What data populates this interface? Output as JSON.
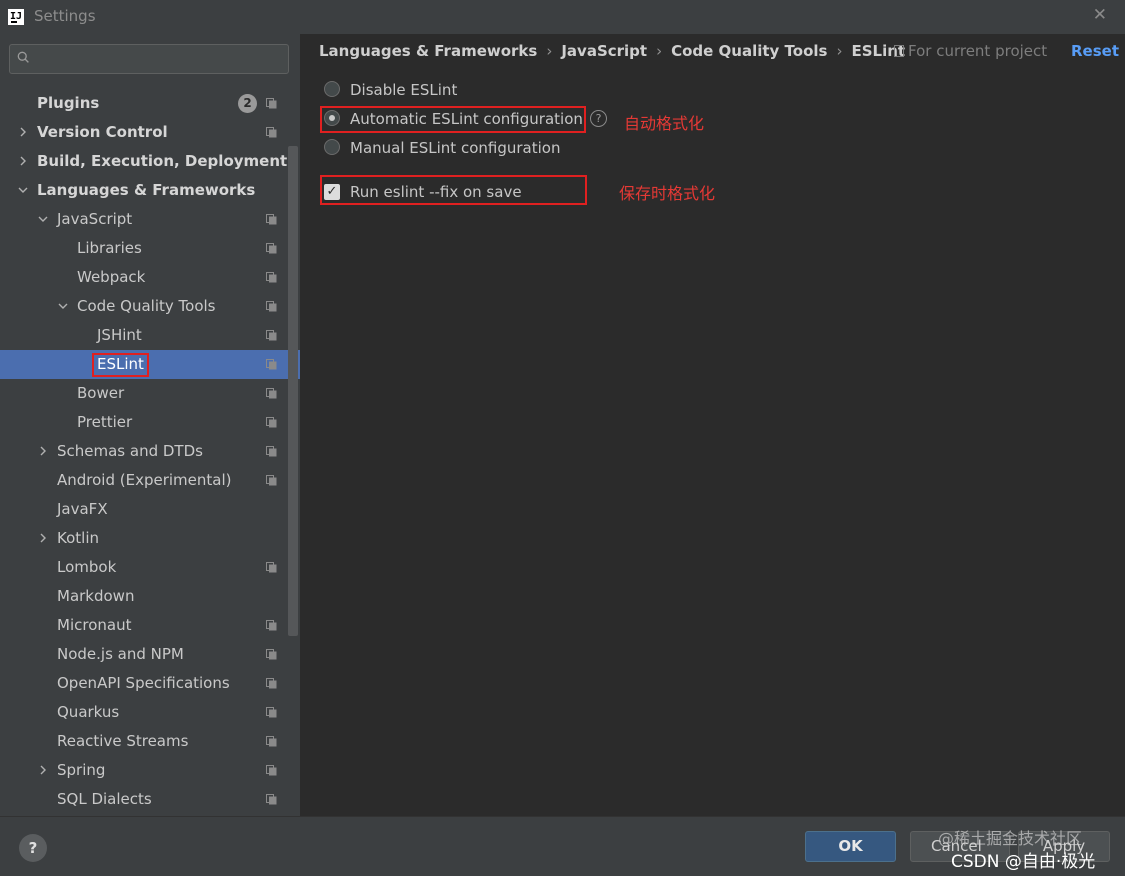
{
  "window": {
    "title": "Settings",
    "app_icon": "intellij-icon",
    "close_icon": "close-icon"
  },
  "sidebar": {
    "search": {
      "placeholder": "",
      "value": ""
    },
    "items": [
      {
        "label": "Plugins",
        "level": 0,
        "bold": true,
        "arrow": "none",
        "badge": "2",
        "project_icon": true
      },
      {
        "label": "Version Control",
        "level": 0,
        "bold": true,
        "arrow": "right",
        "project_icon": true
      },
      {
        "label": "Build, Execution, Deployment",
        "level": 0,
        "bold": true,
        "arrow": "right",
        "project_icon": false
      },
      {
        "label": "Languages & Frameworks",
        "level": 0,
        "bold": true,
        "arrow": "down",
        "project_icon": false
      },
      {
        "label": "JavaScript",
        "level": 1,
        "bold": false,
        "arrow": "down",
        "project_icon": true
      },
      {
        "label": "Libraries",
        "level": 2,
        "bold": false,
        "arrow": "none",
        "project_icon": true
      },
      {
        "label": "Webpack",
        "level": 2,
        "bold": false,
        "arrow": "none",
        "project_icon": true
      },
      {
        "label": "Code Quality Tools",
        "level": 2,
        "bold": false,
        "arrow": "down",
        "project_icon": true
      },
      {
        "label": "JSHint",
        "level": 3,
        "bold": false,
        "arrow": "none",
        "project_icon": true
      },
      {
        "label": "ESLint",
        "level": 3,
        "bold": false,
        "arrow": "none",
        "project_icon": true,
        "selected": true
      },
      {
        "label": "Bower",
        "level": 2,
        "bold": false,
        "arrow": "none",
        "project_icon": true
      },
      {
        "label": "Prettier",
        "level": 2,
        "bold": false,
        "arrow": "none",
        "project_icon": true
      },
      {
        "label": "Schemas and DTDs",
        "level": 1,
        "bold": false,
        "arrow": "right",
        "project_icon": true
      },
      {
        "label": "Android (Experimental)",
        "level": 1,
        "bold": false,
        "arrow": "none",
        "project_icon": true
      },
      {
        "label": "JavaFX",
        "level": 1,
        "bold": false,
        "arrow": "none",
        "project_icon": false
      },
      {
        "label": "Kotlin",
        "level": 1,
        "bold": false,
        "arrow": "right",
        "project_icon": false
      },
      {
        "label": "Lombok",
        "level": 1,
        "bold": false,
        "arrow": "none",
        "project_icon": true
      },
      {
        "label": "Markdown",
        "level": 1,
        "bold": false,
        "arrow": "none",
        "project_icon": false
      },
      {
        "label": "Micronaut",
        "level": 1,
        "bold": false,
        "arrow": "none",
        "project_icon": true
      },
      {
        "label": "Node.js and NPM",
        "level": 1,
        "bold": false,
        "arrow": "none",
        "project_icon": true
      },
      {
        "label": "OpenAPI Specifications",
        "level": 1,
        "bold": false,
        "arrow": "none",
        "project_icon": true
      },
      {
        "label": "Quarkus",
        "level": 1,
        "bold": false,
        "arrow": "none",
        "project_icon": true
      },
      {
        "label": "Reactive Streams",
        "level": 1,
        "bold": false,
        "arrow": "none",
        "project_icon": true
      },
      {
        "label": "Spring",
        "level": 1,
        "bold": false,
        "arrow": "right",
        "project_icon": true
      },
      {
        "label": "SQL Dialects",
        "level": 1,
        "bold": false,
        "arrow": "none",
        "project_icon": true
      }
    ]
  },
  "breadcrumb": {
    "items": [
      "Languages & Frameworks",
      "JavaScript",
      "Code Quality Tools",
      "ESLint"
    ],
    "separator": "›"
  },
  "header": {
    "for_project": "For current project",
    "reset": "Reset"
  },
  "options": {
    "disable": "Disable ESLint",
    "automatic": "Automatic ESLint configuration",
    "manual": "Manual ESLint configuration",
    "selected": "automatic",
    "run_fix": {
      "label": "Run eslint --fix on save",
      "checked": true
    },
    "help_glyph": "?"
  },
  "annotations": {
    "auto_format": "自动格式化",
    "format_on_save": "保存时格式化"
  },
  "footer": {
    "help": "?",
    "ok": "OK",
    "cancel": "Cancel",
    "apply": "Apply"
  },
  "watermark": {
    "line1": "@稀土掘金技术社区",
    "line2": "CSDN @自由·极光"
  },
  "colors": {
    "selection": "#4b6eaf",
    "accent_link": "#589df6",
    "annotation_red": "#e02020",
    "ok_button": "#365880"
  }
}
